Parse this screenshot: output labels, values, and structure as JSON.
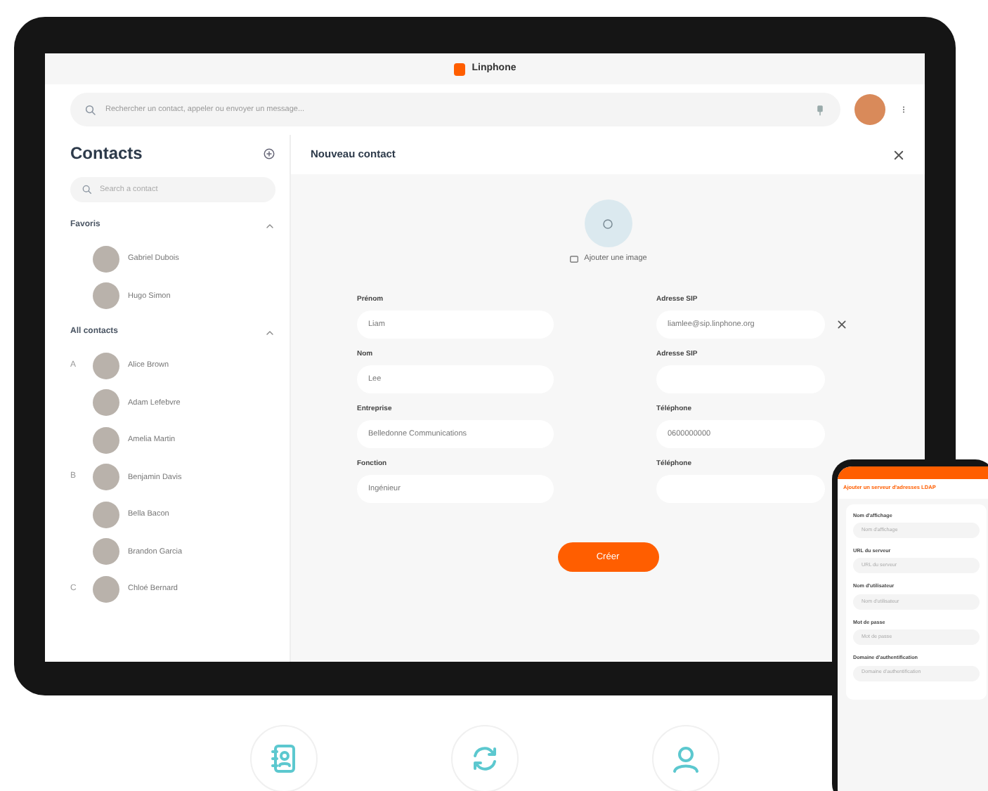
{
  "app": {
    "title": "Linphone"
  },
  "search": {
    "placeholder": "Rechercher un contact, appeler ou envoyer un message..."
  },
  "sidebar": {
    "title": "Contacts",
    "search_placeholder": "Search a contact",
    "sections": [
      {
        "title": "Favoris",
        "expanded": true,
        "groups": [
          {
            "contacts": [
              "Gabriel Dubois",
              "Hugo Simon"
            ]
          }
        ]
      },
      {
        "title": "All contacts",
        "expanded": true,
        "groups": [
          {
            "letter": "A",
            "contacts": [
              "Alice Brown",
              "Adam Lefebvre",
              "Amelia Martin"
            ]
          },
          {
            "letter": "B",
            "contacts": [
              "Benjamin Davis",
              "Bella Bacon",
              "Brandon Garcia"
            ]
          },
          {
            "letter": "C",
            "contacts": [
              "Chloé Bernard"
            ]
          }
        ]
      }
    ]
  },
  "panel": {
    "title": "Nouveau contact",
    "add_image": "Ajouter une image",
    "left_fields": [
      {
        "label": "Prénom",
        "value": "Liam",
        "removable": false
      },
      {
        "label": "Nom",
        "value": "Lee",
        "removable": false
      },
      {
        "label": "Entreprise",
        "value": "Belledonne Communications",
        "removable": false
      },
      {
        "label": "Fonction",
        "value": "Ingénieur",
        "removable": false
      }
    ],
    "right_fields": [
      {
        "label": "Adresse SIP",
        "value": "liamlee@sip.linphone.org",
        "removable": true
      },
      {
        "label": "Adresse SIP",
        "removable": false
      },
      {
        "label": "Téléphone",
        "value": "0600000000",
        "removable": false
      },
      {
        "label": "Téléphone",
        "removable": false
      }
    ],
    "submit": "Créer"
  },
  "phone": {
    "title": "Ajouter un serveur d'adresses LDAP",
    "fields": [
      {
        "label": "Nom d'affichage",
        "placeholder": "Nom d'affichage"
      },
      {
        "label": "URL du serveur",
        "placeholder": "URL du serveur"
      },
      {
        "label": "Nom d'utilisateur",
        "placeholder": "Nom d'utilisateur"
      },
      {
        "label": "Mot de passe",
        "placeholder": "Mot de passe"
      },
      {
        "label": "Domaine d'authentification",
        "placeholder": "Domaine d'authentification"
      }
    ]
  }
}
